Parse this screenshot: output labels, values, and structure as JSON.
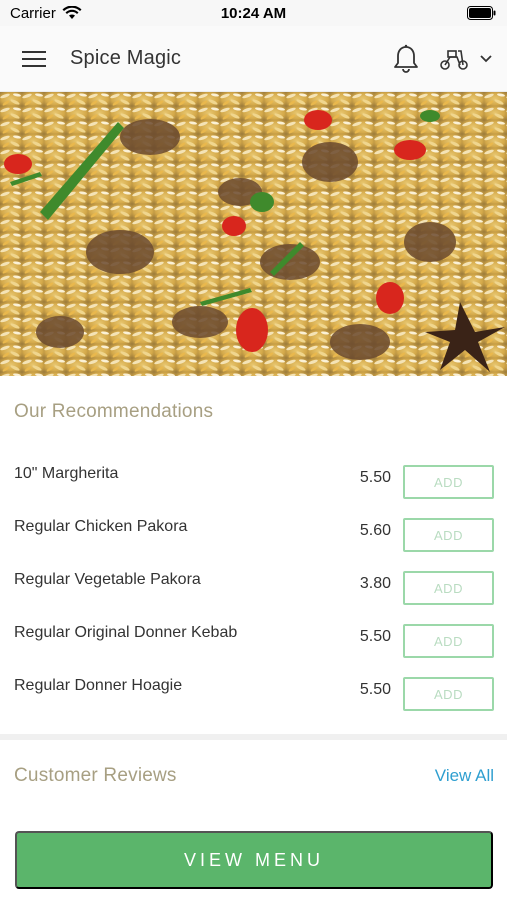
{
  "status_bar": {
    "carrier": "Carrier",
    "time": "10:24 AM"
  },
  "header": {
    "title": "Spice Magic",
    "menu_icon": "hamburger-icon",
    "bell_icon": "bell-icon",
    "delivery_icon": "scooter-icon",
    "dropdown_icon": "chevron-down-icon"
  },
  "hero": {
    "image": "biryani-dish"
  },
  "recommendations": {
    "title": "Our Recommendations",
    "items": [
      {
        "name": "10\" Margherita",
        "price": "5.50",
        "action": "ADD"
      },
      {
        "name": "Regular Chicken Pakora",
        "price": "5.60",
        "action": "ADD"
      },
      {
        "name": "Regular Vegetable Pakora",
        "price": "3.80",
        "action": "ADD"
      },
      {
        "name": "Regular Original Donner Kebab",
        "price": "5.50",
        "action": "ADD"
      },
      {
        "name": "Regular Donner Hoagie",
        "price": "5.50",
        "action": "ADD"
      }
    ]
  },
  "reviews": {
    "title": "Customer Reviews",
    "view_all": "View All"
  },
  "footer": {
    "button_label": "VIEW MENU"
  },
  "colors": {
    "accent_green": "#5bb56b",
    "link_blue": "#2f9fd0",
    "section_title": "#a79f82"
  }
}
